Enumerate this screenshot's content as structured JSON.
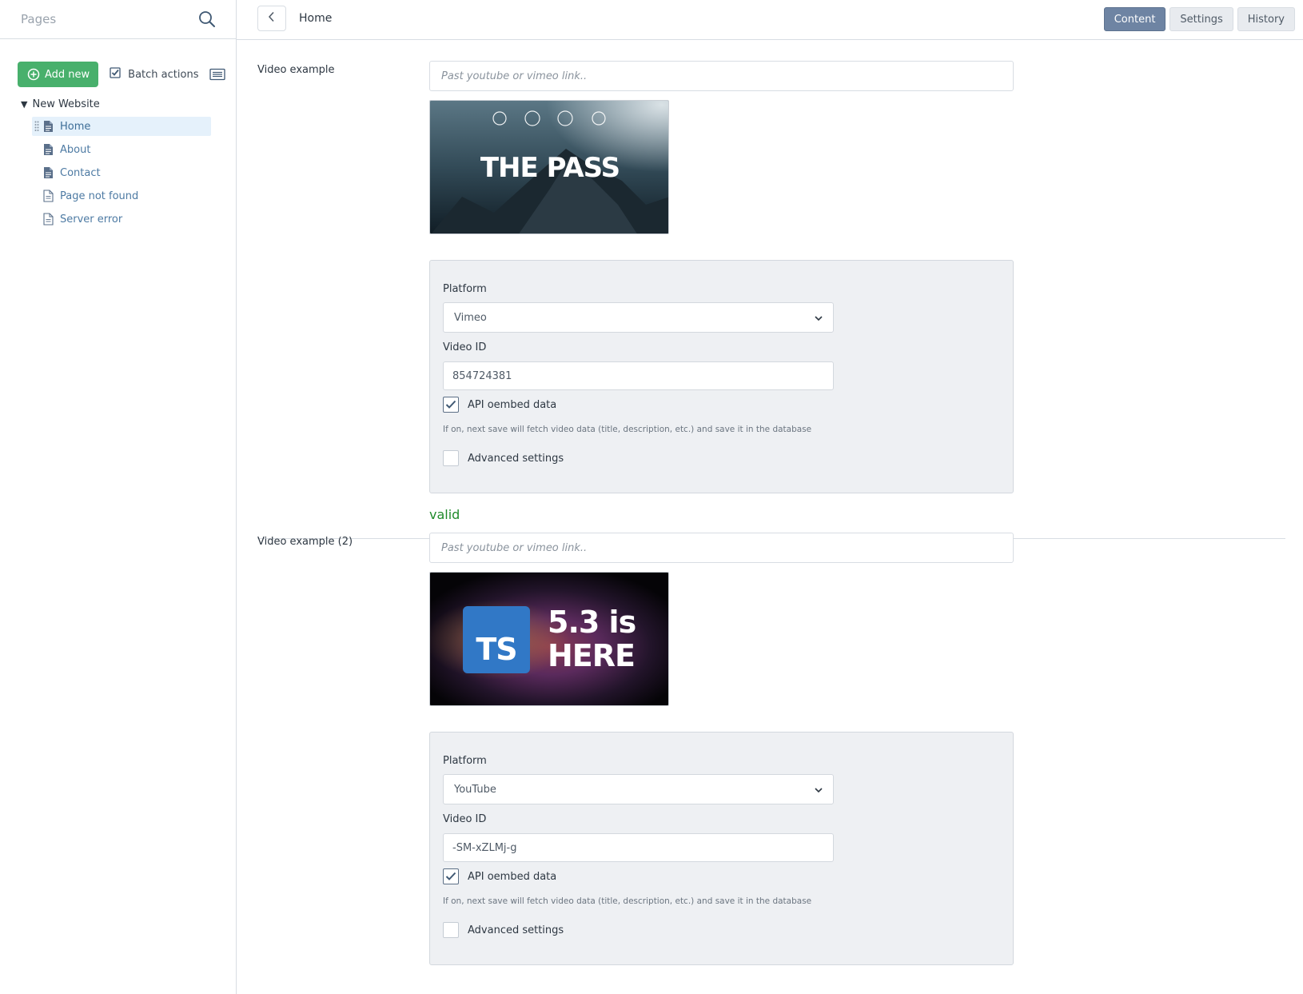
{
  "sidebar": {
    "title": "Pages",
    "add_new_label": "Add new",
    "batch_actions_label": "Batch actions",
    "tree_root_label": "New Website",
    "items": [
      {
        "label": "Home",
        "icon": "page-icon",
        "active": true
      },
      {
        "label": "About",
        "icon": "page-icon"
      },
      {
        "label": "Contact",
        "icon": "page-icon"
      },
      {
        "label": "Page not found",
        "icon": "page-outline-icon"
      },
      {
        "label": "Server error",
        "icon": "page-outline-icon"
      }
    ]
  },
  "topbar": {
    "page_title": "Home",
    "tabs": [
      {
        "label": "Content",
        "active": true
      },
      {
        "label": "Settings"
      },
      {
        "label": "History"
      }
    ]
  },
  "fields": [
    {
      "label": "Video example",
      "url_placeholder": "Past youtube or vimeo link..",
      "thumbnail_text": "THE PASS",
      "platform_label": "Platform",
      "platform_value": "Vimeo",
      "video_id_label": "Video ID",
      "video_id_value": "854724381",
      "oembed_label": "API oembed data",
      "oembed_checked": true,
      "help_text": "If on, next save will fetch video data (title, description, etc.) and save it in the database",
      "advanced_label": "Advanced settings",
      "advanced_checked": false,
      "status": "valid"
    },
    {
      "label": "Video example (2)",
      "url_placeholder": "Past youtube or vimeo link..",
      "thumbnail_logo": "TS",
      "thumbnail_line1": "5.3 is",
      "thumbnail_line2": "HERE",
      "platform_label": "Platform",
      "platform_value": "YouTube",
      "video_id_label": "Video ID",
      "video_id_value": "-SM-xZLMj-g",
      "oembed_label": "API oembed data",
      "oembed_checked": true,
      "help_text": "If on, next save will fetch video data (title, description, etc.) and save it in the database",
      "advanced_label": "Advanced settings",
      "advanced_checked": false
    }
  ],
  "colors": {
    "accent_green": "#48b06c",
    "active_tab": "#6e84a3",
    "link_blue": "#4d7aa3",
    "valid_green": "#1f8a2a"
  }
}
